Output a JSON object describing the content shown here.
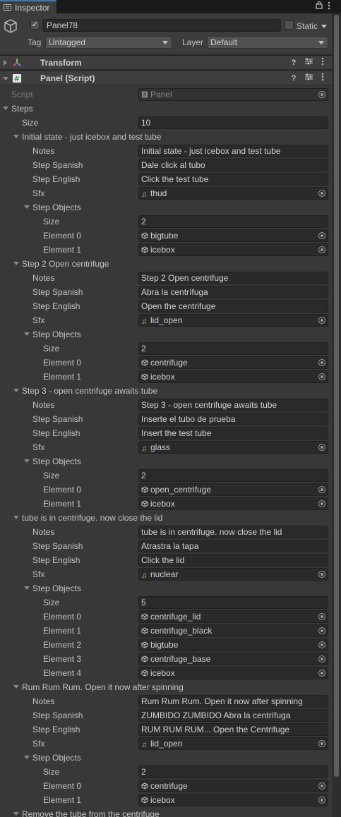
{
  "tab": {
    "title": "Inspector"
  },
  "header": {
    "name": "Panel78",
    "static_label": "Static",
    "tag_label": "Tag",
    "tag_value": "Untagged",
    "layer_label": "Layer",
    "layer_value": "Default"
  },
  "components": [
    {
      "title": "Transform",
      "expanded": false
    },
    {
      "title": "Panel (Script)",
      "expanded": true
    }
  ],
  "script": {
    "label": "Script",
    "value": "Panel"
  },
  "steps": {
    "label": "Steps",
    "size_label": "Size",
    "size": "10",
    "items": [
      {
        "title": "Initial state - just icebox and test tube",
        "notes": "Initial state - just icebox and test tube",
        "spanish": "Dale click al tubo",
        "english": "Click the test tube",
        "sfx": "thud",
        "objects_size": "2",
        "objects": [
          "bigtube",
          "icebox"
        ]
      },
      {
        "title": "Step 2 Open centrifuge",
        "notes": "Step 2 Open centrifuge",
        "spanish": "Abra la centrífuga",
        "english": "Open the centrifuge",
        "sfx": "lid_open",
        "objects_size": "2",
        "objects": [
          "centrifuge",
          "icebox"
        ]
      },
      {
        "title": "Step 3 - open centrifuge awaits tube",
        "notes": "Step 3 - open centrifuge awaits tube",
        "spanish": "Inserte el tubo de prueba",
        "english": "Insert the test tube",
        "sfx": "glass",
        "objects_size": "2",
        "objects": [
          "open_centrifuge",
          "icebox"
        ]
      },
      {
        "title": "tube is in centrifuge. now close the lid",
        "notes": "tube is in centrifuge. now close the lid",
        "spanish": "Atrastra la tapa",
        "english": "Click the lid",
        "sfx": "nuclear",
        "objects_size": "5",
        "objects": [
          "centrifuge_lid",
          "centrifuge_black",
          "bigtube",
          "centrifuge_base",
          "icebox"
        ]
      },
      {
        "title": "Rum Rum Rum. Open it now after spinning",
        "notes": "Rum Rum Rum. Open it now after spinning",
        "spanish": "ZUMBIDO ZUMBIDO Abra la centrífuga",
        "english": "RUM RUM RUM... Open the Centrifuge",
        "sfx": "lid_open",
        "objects_size": "2",
        "objects": [
          "centrifuge",
          "icebox"
        ]
      },
      {
        "title": "Remove the tube from the centrifuge",
        "collapsed": true
      }
    ]
  },
  "field_labels": {
    "notes": "Notes",
    "spanish": "Step Spanish",
    "english": "Step English",
    "sfx": "Sfx",
    "step_objects": "Step Objects",
    "size": "Size",
    "element_prefix": "Element"
  },
  "colors": {
    "accent": "#3a79bb",
    "background": "#383838",
    "field": "#2a2a2a"
  }
}
